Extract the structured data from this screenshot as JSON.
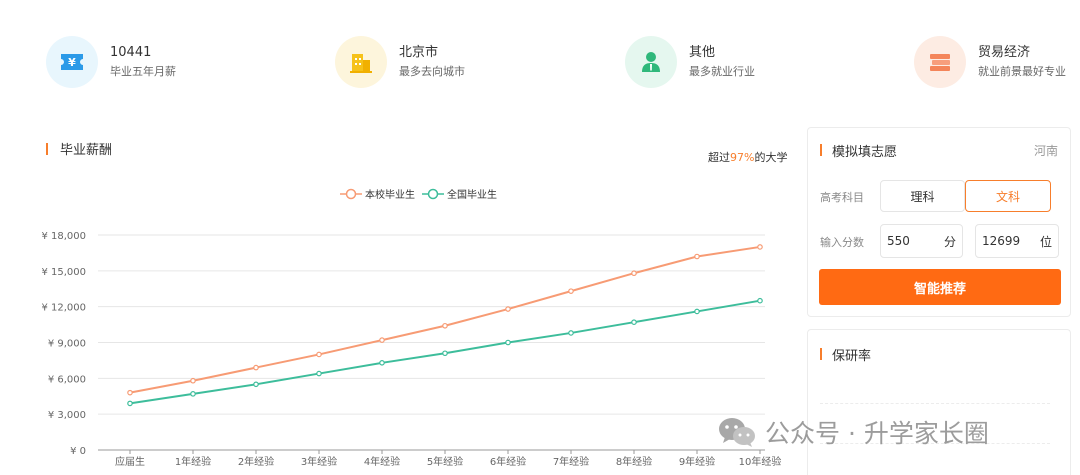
{
  "stats": [
    {
      "value": "10441",
      "label": "毕业五年月薪",
      "icon": "salary-ticket-icon",
      "bg": "#e8f6fd",
      "color": "#2b9ae8"
    },
    {
      "value": "北京市",
      "label": "最多去向城市",
      "icon": "city-buildings-icon",
      "bg": "#fdf5dc",
      "color": "#f6c21a"
    },
    {
      "value": "其他",
      "label": "最多就业行业",
      "icon": "industry-person-icon",
      "bg": "#e5f7ef",
      "color": "#2fb87b"
    },
    {
      "value": "贸易经济",
      "label": "就业前景最好专业",
      "icon": "major-books-icon",
      "bg": "#fdece3",
      "color": "#f4855a"
    }
  ],
  "salary": {
    "title": "毕业薪酬",
    "exceed_prefix": "超过",
    "exceed_pct": "97%",
    "exceed_suffix": "的大学"
  },
  "chart_data": {
    "type": "line",
    "title": "",
    "xlabel": "",
    "ylabel": "",
    "categories": [
      "应届生",
      "1年经验",
      "2年经验",
      "3年经验",
      "4年经验",
      "5年经验",
      "6年经验",
      "7年经验",
      "8年经验",
      "9年经验",
      "10年经验"
    ],
    "y_ticks": [
      "¥ 0",
      "¥ 3,000",
      "¥ 6,000",
      "¥ 9,000",
      "¥ 12,000",
      "¥ 15,000",
      "¥ 18,000"
    ],
    "ylim": [
      0,
      18000
    ],
    "grid": true,
    "legend_position": "top-center",
    "series": [
      {
        "name": "本校毕业生",
        "color": "#f79b74",
        "values": [
          4800,
          5800,
          6900,
          8000,
          9200,
          10400,
          11800,
          13300,
          14800,
          16200,
          17000
        ]
      },
      {
        "name": "全国毕业生",
        "color": "#3dbd9b",
        "values": [
          3900,
          4700,
          5500,
          6400,
          7300,
          8100,
          9000,
          9800,
          10700,
          11600,
          12500
        ]
      }
    ]
  },
  "simulate": {
    "title": "模拟填志愿",
    "province": "河南",
    "subject_label": "高考科目",
    "subject_options": [
      "理科",
      "文科"
    ],
    "selected_subject": "文科",
    "score_label": "输入分数",
    "score_value": "550",
    "score_unit": "分",
    "rank_value": "12699",
    "rank_unit": "位",
    "button_label": "智能推荐"
  },
  "baoyan": {
    "title": "保研率"
  },
  "watermark": {
    "text": "公众号 · 升学家长圈"
  }
}
